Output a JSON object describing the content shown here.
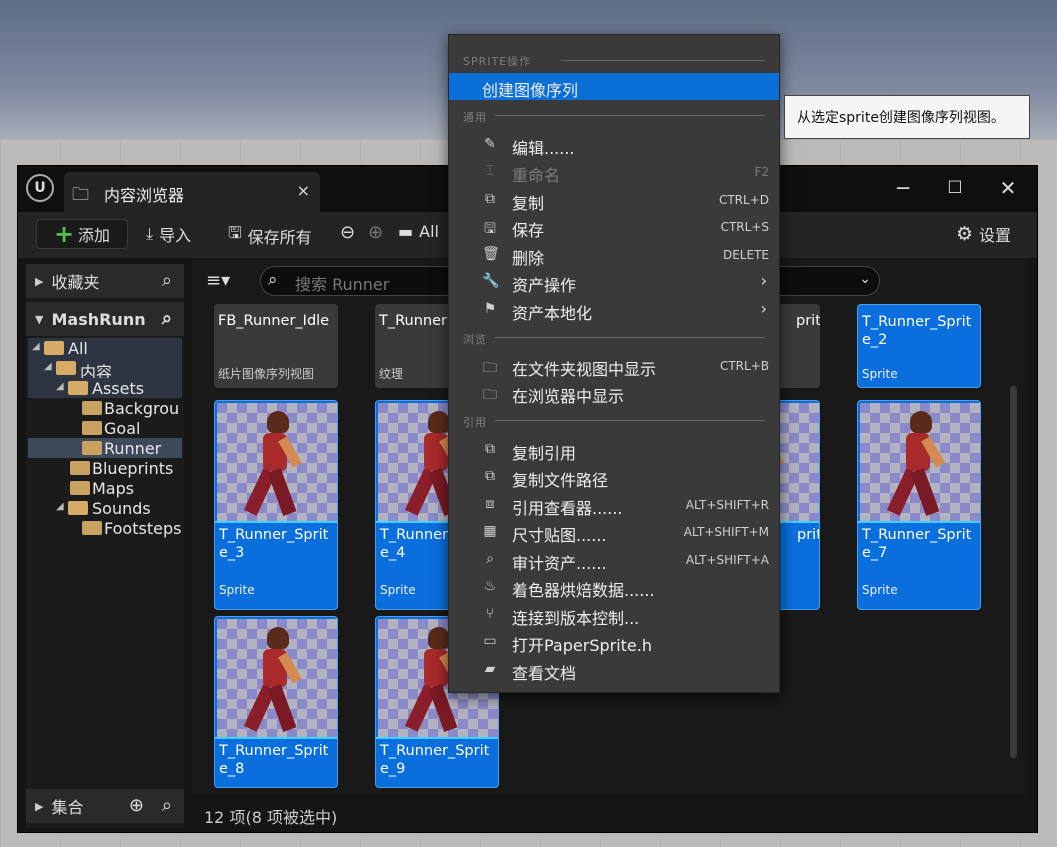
{
  "window": {
    "tab_title": "内容浏览器",
    "close": "×",
    "minimize": "─",
    "maximize": "☐",
    "close_window": "✕"
  },
  "toolbar": {
    "add": "添加",
    "import": "导入",
    "save_all": "保存所有",
    "path_root": "All",
    "settings": "设置"
  },
  "left": {
    "favorites": "收藏夹",
    "project": "MashRunn",
    "collections": "集合",
    "tree": [
      {
        "label": "All"
      },
      {
        "label": "内容"
      },
      {
        "label": "Assets"
      },
      {
        "label": "Backgrou"
      },
      {
        "label": "Goal"
      },
      {
        "label": "Runner"
      },
      {
        "label": "Blueprints"
      },
      {
        "label": "Maps"
      },
      {
        "label": "Sounds"
      },
      {
        "label": "Footsteps"
      }
    ]
  },
  "search": {
    "placeholder": "搜索 Runner"
  },
  "assets": [
    {
      "name": "FB_Runner_Idle",
      "type": "纸片图像序列视图"
    },
    {
      "name": "T_Runner",
      "type": "纹理"
    },
    {
      "name": "prite",
      "type": ""
    },
    {
      "name": "T_Runner_Sprite_2",
      "type": "Sprite"
    },
    {
      "name": "T_Runner_Sprite_3",
      "type": "Sprite"
    },
    {
      "name": "T_Runner_Sprite_4",
      "type": "Sprite"
    },
    {
      "name": "prite",
      "type": ""
    },
    {
      "name": "T_Runner_Sprite_7",
      "type": "Sprite"
    },
    {
      "name": "T_Runner_Sprite_8",
      "type": ""
    },
    {
      "name": "T_Runner_Sprite_9",
      "type": ""
    }
  ],
  "status": "12 项(8 项被选中)",
  "menu": {
    "sec_sprite": "SPRITE操作",
    "create_seq": "创建图像序列",
    "sec_common": "通用",
    "edit": "编辑......",
    "rename": "重命名",
    "rename_sc": "F2",
    "copy": "复制",
    "copy_sc": "CTRL+D",
    "save": "保存",
    "save_sc": "CTRL+S",
    "delete": "删除",
    "delete_sc": "DELETE",
    "asset_ops": "资产操作",
    "localize": "资产本地化",
    "sec_browse": "浏览",
    "show_folder": "在文件夹视图中显示",
    "show_folder_sc": "CTRL+B",
    "show_browser": "在浏览器中显示",
    "sec_ref": "引用",
    "copy_ref": "复制引用",
    "copy_path": "复制文件路径",
    "ref_viewer": "引用查看器......",
    "ref_viewer_sc": "ALT+SHIFT+R",
    "size_map": "尺寸贴图......",
    "size_map_sc": "ALT+SHIFT+M",
    "audit": "审计资产......",
    "audit_sc": "ALT+SHIFT+A",
    "shader": "着色器烘焙数据......",
    "vcs": "连接到版本控制...",
    "open_h": "打开PaperSprite.h",
    "docs": "查看文档"
  },
  "tooltip": "从选定sprite创建图像序列视图。"
}
